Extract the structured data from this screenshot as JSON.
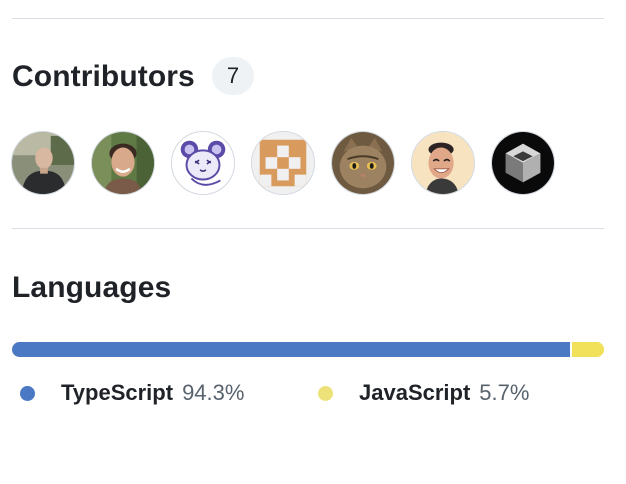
{
  "contributors": {
    "title": "Contributors",
    "count": "7",
    "avatars": [
      {
        "icon": "person-photo-avatar"
      },
      {
        "icon": "person-photo-avatar"
      },
      {
        "icon": "mouse-cartoon-avatar"
      },
      {
        "icon": "identicon-avatar"
      },
      {
        "icon": "cat-photo-avatar"
      },
      {
        "icon": "cartoon-face-avatar"
      },
      {
        "icon": "cube-logo-avatar"
      }
    ]
  },
  "languages": {
    "title": "Languages",
    "items": [
      {
        "name": "TypeScript",
        "percent": "94.3%",
        "value": 94.3,
        "color": "#3178c6"
      },
      {
        "name": "JavaScript",
        "percent": "5.7%",
        "value": 5.7,
        "color": "#f1e05a"
      }
    ]
  }
}
